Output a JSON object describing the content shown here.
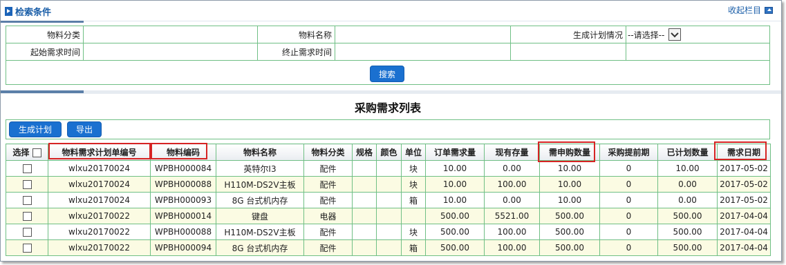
{
  "search_panel": {
    "title": "检索条件",
    "collapse_label": "收起栏目"
  },
  "search_form": {
    "row1": {
      "material_category_label": "物料分类",
      "material_name_label": "物料名称",
      "plan_status_label": "生成计划情况",
      "plan_status_value": "--请选择--"
    },
    "row2": {
      "start_time_label": "起始需求时间",
      "end_time_label": "终止需求时间"
    },
    "search_button": "搜索"
  },
  "list": {
    "title": "采购需求列表",
    "toolbar": {
      "generate_plan_button": "生成计划",
      "export_button": "导出"
    },
    "columns": [
      "选择",
      "物料需求计划单编号",
      "物料编码",
      "物料名称",
      "物料分类",
      "规格",
      "颜色",
      "单位",
      "订单需求量",
      "现有存量",
      "需申购数量",
      "采购提前期",
      "已计划数量",
      "需求日期"
    ],
    "rows": [
      [
        "wlxu20170024",
        "WPBH000084",
        "英特尔I3",
        "配件",
        "",
        "",
        "块",
        "10.00",
        "0.00",
        "10.00",
        "0",
        "10.00",
        "2017-05-02"
      ],
      [
        "wlxu20170024",
        "WPBH000088",
        "H110M-DS2V主板",
        "配件",
        "",
        "",
        "块",
        "10.00",
        "100.00",
        "10.00",
        "0",
        "0.00",
        "2017-05-02"
      ],
      [
        "wlxu20170024",
        "WPBH000093",
        "8G 台式机内存",
        "配件",
        "",
        "",
        "箱",
        "10.00",
        "0.00",
        "10.00",
        "0",
        "0.00",
        "2017-05-02"
      ],
      [
        "wlxu20170022",
        "WPBH000014",
        "键盘",
        "电器",
        "",
        "",
        "",
        "500.00",
        "5521.00",
        "500.00",
        "0",
        "500.00",
        "2017-04-04"
      ],
      [
        "wlxu20170022",
        "WPBH000088",
        "H110M-DS2V主板",
        "配件",
        "",
        "",
        "块",
        "500.00",
        "100.00",
        "500.00",
        "0",
        "500.00",
        "2017-04-04"
      ],
      [
        "wlxu20170022",
        "WPBH000094",
        "8G 台式机内存",
        "配件",
        "",
        "",
        "箱",
        "500.00",
        "100.00",
        "500.00",
        "0",
        "500.00",
        "2017-04-04"
      ]
    ]
  },
  "colors": {
    "accent_blue": "#1a70d0",
    "grid_border": "#6fbf84",
    "alt_row": "#fbfbe3",
    "highlight_red": "#d62424"
  }
}
